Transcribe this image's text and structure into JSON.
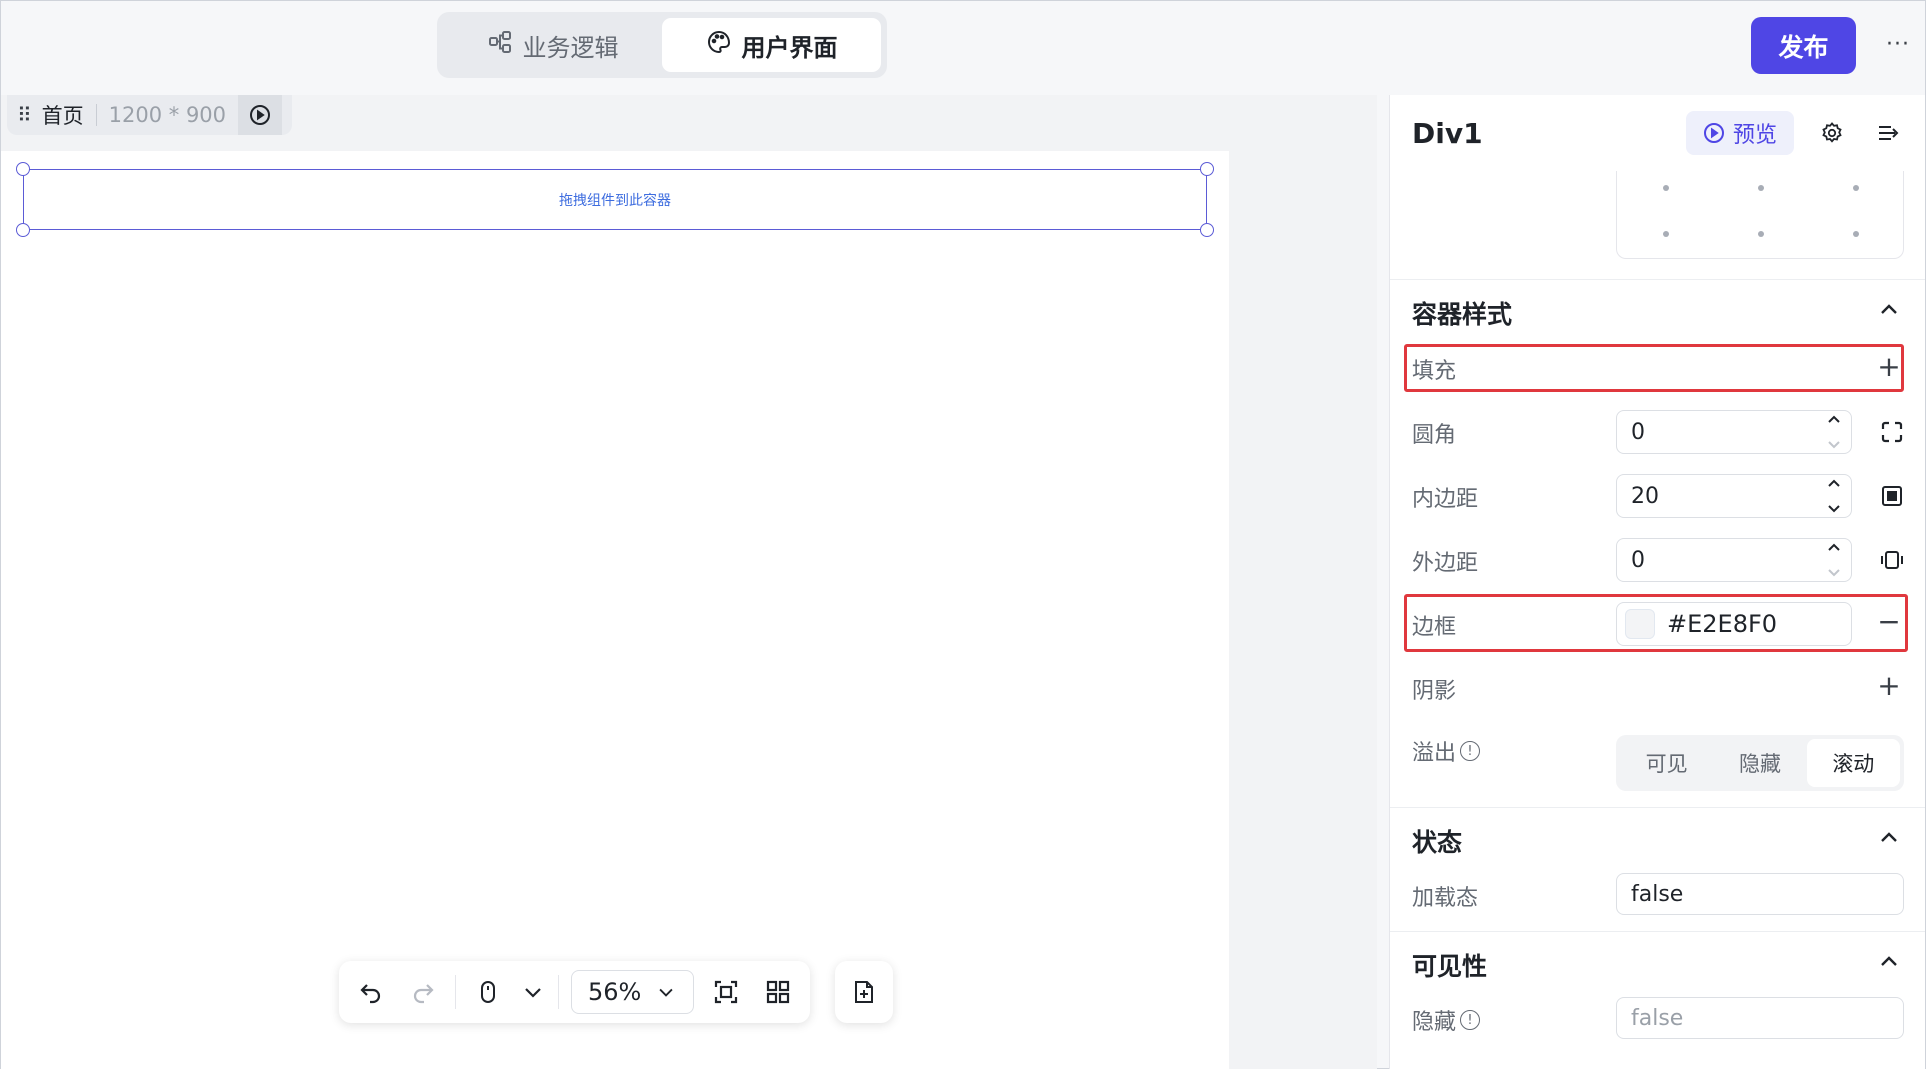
{
  "header": {
    "mode_tabs": [
      {
        "label": "业务逻辑",
        "icon": "flow-icon",
        "active": false
      },
      {
        "label": "用户界面",
        "icon": "palette-icon",
        "active": true
      }
    ],
    "publish_label": "发布",
    "more_label": "···"
  },
  "canvas": {
    "page_name": "首页",
    "page_size": "1200 * 900",
    "drop_hint": "拖拽组件到此容器",
    "zoom": "56%"
  },
  "panel": {
    "title": "Div1",
    "preview_label": "预览",
    "container_style": {
      "title": "容器样式",
      "fill_label": "填充",
      "radius_label": "圆角",
      "radius_value": "0",
      "padding_label": "内边距",
      "padding_value": "20",
      "margin_label": "外边距",
      "margin_value": "0",
      "border_label": "边框",
      "border_value": "#E2E8F0",
      "shadow_label": "阴影",
      "overflow_label": "溢出",
      "overflow_options": [
        "可见",
        "隐藏",
        "滚动"
      ],
      "overflow_selected": "滚动"
    },
    "state": {
      "title": "状态",
      "loading_label": "加载态",
      "loading_value": "false"
    },
    "visibility": {
      "title": "可见性",
      "hidden_label": "隐藏",
      "hidden_value": "false"
    }
  },
  "colors": {
    "accent": "#4f46e5",
    "highlight": "#e0383e",
    "selection": "#5b5bd6"
  }
}
